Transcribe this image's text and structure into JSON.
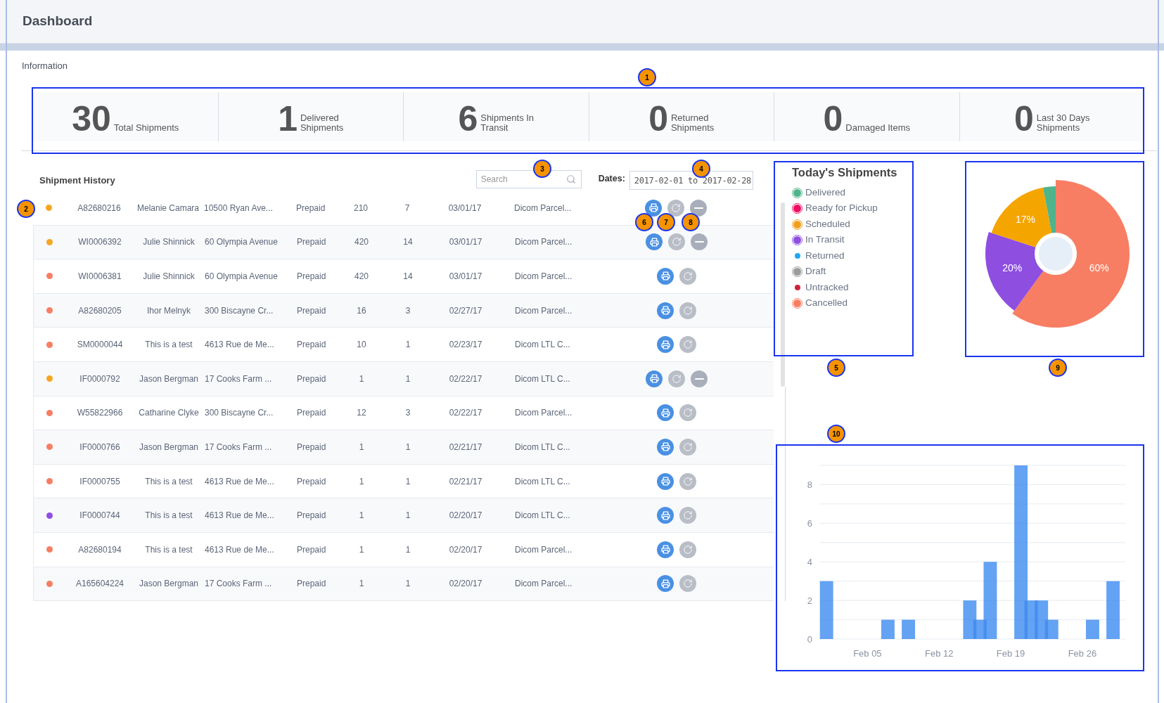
{
  "header": {
    "title": "Dashboard"
  },
  "section_title": "Information",
  "stats": [
    {
      "value": "30",
      "lines": [
        "Total Shipments"
      ]
    },
    {
      "value": "1",
      "lines": [
        "Delivered",
        "Shipments"
      ]
    },
    {
      "value": "6",
      "lines": [
        "Shipments In",
        "Transit"
      ]
    },
    {
      "value": "0",
      "lines": [
        "Returned",
        "Shipments"
      ]
    },
    {
      "value": "0",
      "lines": [
        "Damaged Items"
      ]
    },
    {
      "value": "0",
      "lines": [
        "Last 30 Days",
        "Shipments"
      ]
    }
  ],
  "history": {
    "title": "Shipment History",
    "search": {
      "placeholder": "Search"
    },
    "dates_label": "Dates:",
    "dates_value": "2017-02-01 to 2017-02-28",
    "rows": [
      {
        "color": "#f5a623",
        "id": "A82680216",
        "name": "Melanie Camara",
        "address": "10500 Ryan Ave...",
        "payment": "Prepaid",
        "column_6": "210",
        "column_7": "7",
        "date": "03/01/17",
        "carrier": "Dicom Parcel...",
        "actions": [
          {
            "kind": "print"
          },
          {
            "kind": "refresh"
          },
          {
            "kind": "cancel"
          }
        ]
      },
      {
        "color": "#f5a623",
        "id": "WI0006392",
        "name": "Julie Shinnick",
        "address": "60 Olympia Avenue",
        "payment": "Prepaid",
        "column_6": "420",
        "column_7": "14",
        "date": "03/01/17",
        "carrier": "Dicom Parcel...",
        "actions": [
          {
            "kind": "print"
          },
          {
            "kind": "refresh"
          },
          {
            "kind": "cancel"
          }
        ]
      },
      {
        "color": "#f77e63",
        "id": "WI0006381",
        "name": "Julie Shinnick",
        "address": "60 Olympia Avenue",
        "payment": "Prepaid",
        "column_6": "420",
        "column_7": "14",
        "date": "03/01/17",
        "carrier": "Dicom Parcel...",
        "actions": [
          {
            "kind": "print"
          },
          {
            "kind": "refresh"
          }
        ]
      },
      {
        "color": "#f77e63",
        "id": "A82680205",
        "name": "Ihor Melnyk",
        "address": "300 Biscayne Cr...",
        "payment": "Prepaid",
        "column_6": "16",
        "column_7": "3",
        "date": "02/27/17",
        "carrier": "Dicom Parcel...",
        "actions": [
          {
            "kind": "print"
          },
          {
            "kind": "refresh"
          }
        ]
      },
      {
        "color": "#f77e63",
        "id": "SM0000044",
        "name": "This is a test",
        "address": "4613 Rue de Me...",
        "payment": "Prepaid",
        "column_6": "10",
        "column_7": "1",
        "date": "02/23/17",
        "carrier": "Dicom LTL C...",
        "actions": [
          {
            "kind": "print"
          },
          {
            "kind": "refresh"
          }
        ]
      },
      {
        "color": "#f5a623",
        "id": "IF0000792",
        "name": "Jason Bergman",
        "address": "17 Cooks Farm ...",
        "payment": "Prepaid",
        "column_6": "1",
        "column_7": "1",
        "date": "02/22/17",
        "carrier": "Dicom LTL C...",
        "actions": [
          {
            "kind": "print"
          },
          {
            "kind": "refresh"
          },
          {
            "kind": "cancel"
          }
        ]
      },
      {
        "color": "#f77e63",
        "id": "W55822966",
        "name": "Catharine Clyke",
        "address": "300 Biscayne Cr...",
        "payment": "Prepaid",
        "column_6": "12",
        "column_7": "3",
        "date": "02/22/17",
        "carrier": "Dicom Parcel...",
        "actions": [
          {
            "kind": "print"
          },
          {
            "kind": "refresh"
          }
        ]
      },
      {
        "color": "#f77e63",
        "id": "IF0000766",
        "name": "Jason Bergman",
        "address": "17 Cooks Farm ...",
        "payment": "Prepaid",
        "column_6": "1",
        "column_7": "1",
        "date": "02/21/17",
        "carrier": "Dicom LTL C...",
        "actions": [
          {
            "kind": "print"
          },
          {
            "kind": "refresh"
          }
        ]
      },
      {
        "color": "#f77e63",
        "id": "IF0000755",
        "name": "This is a test",
        "address": "4613 Rue de Me...",
        "payment": "Prepaid",
        "column_6": "1",
        "column_7": "1",
        "date": "02/21/17",
        "carrier": "Dicom LTL C...",
        "actions": [
          {
            "kind": "print"
          },
          {
            "kind": "refresh"
          }
        ]
      },
      {
        "color": "#8e4ee0",
        "id": "IF0000744",
        "name": "This is a test",
        "address": "4613 Rue de Me...",
        "payment": "Prepaid",
        "column_6": "1",
        "column_7": "1",
        "date": "02/20/17",
        "carrier": "Dicom LTL C...",
        "actions": [
          {
            "kind": "print"
          },
          {
            "kind": "refresh"
          }
        ]
      },
      {
        "color": "#f77e63",
        "id": "A82680194",
        "name": "This is a test",
        "address": "4613 Rue de Me...",
        "payment": "Prepaid",
        "column_6": "1",
        "column_7": "1",
        "date": "02/20/17",
        "carrier": "Dicom Parcel...",
        "actions": [
          {
            "kind": "print"
          },
          {
            "kind": "refresh"
          }
        ]
      },
      {
        "color": "#f77e63",
        "id": "A165604224",
        "name": "Jason Bergman",
        "address": "17 Cooks Farm ...",
        "payment": "Prepaid",
        "column_6": "1",
        "column_7": "1",
        "date": "02/20/17",
        "carrier": "Dicom Parcel...",
        "actions": [
          {
            "kind": "print"
          },
          {
            "kind": "refresh"
          }
        ]
      }
    ]
  },
  "legend": {
    "title": "Today's Shipments",
    "items": [
      {
        "label": "Delivered",
        "color": "#4fb38c",
        "kind": "ring"
      },
      {
        "label": "Ready for Pickup",
        "color": "#ee0e64",
        "kind": "ring"
      },
      {
        "label": "Scheduled",
        "color": "#f0a020",
        "kind": "ring"
      },
      {
        "label": "In Transit",
        "color": "#8e4ee0",
        "kind": "ring"
      },
      {
        "label": "Returned",
        "color": "#1ea7f5",
        "kind": "dot"
      },
      {
        "label": "Draft",
        "color": "#9b9b9b",
        "kind": "ring"
      },
      {
        "label": "Untracked",
        "color": "#d0243c",
        "kind": "dot"
      },
      {
        "label": "Cancelled",
        "color": "#f77e63",
        "kind": "ring"
      }
    ]
  },
  "pie": {
    "chart_data": {
      "type": "donut",
      "values": [
        60,
        20,
        17,
        3
      ],
      "colors": [
        "#f77e63",
        "#8e4ee0",
        "#f5a500",
        "#4fb38c"
      ],
      "value_labels": [
        "60%",
        "20%",
        "17%",
        null
      ]
    }
  },
  "bars": {
    "chart_data": {
      "type": "bar",
      "categories": [
        null,
        null,
        null,
        null,
        "Feb 05",
        null,
        null,
        null,
        null,
        null,
        null,
        "Feb 12",
        null,
        null,
        null,
        null,
        null,
        null,
        "Feb 19",
        null,
        null,
        null,
        null,
        null,
        null,
        "Feb 26",
        null,
        null,
        null,
        null
      ],
      "values": [
        3,
        null,
        null,
        null,
        null,
        null,
        1,
        null,
        1,
        null,
        null,
        null,
        null,
        null,
        2,
        1,
        4,
        null,
        null,
        9,
        2,
        2,
        1,
        null,
        null,
        null,
        1,
        null,
        3,
        null
      ],
      "ylim": [
        0,
        9
      ],
      "yticks": [
        0,
        2,
        4,
        6,
        8
      ],
      "grid": true
    }
  },
  "callouts": [
    {
      "label": "1"
    },
    {
      "label": "2"
    },
    {
      "label": "3"
    },
    {
      "label": "4"
    },
    {
      "label": "5"
    },
    {
      "label": "6"
    },
    {
      "label": "7"
    },
    {
      "label": "8"
    },
    {
      "label": "9"
    },
    {
      "label": "10"
    }
  ]
}
